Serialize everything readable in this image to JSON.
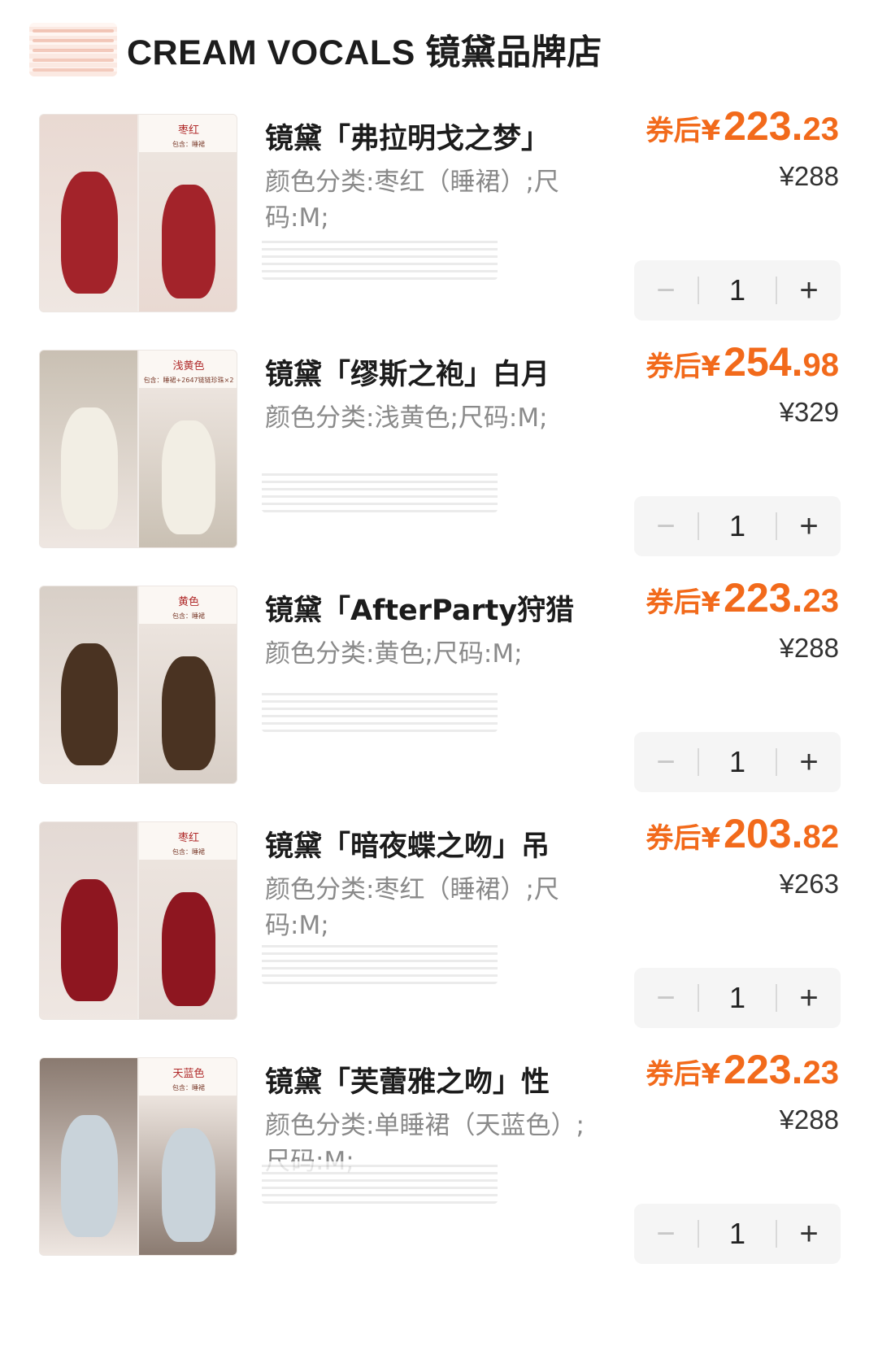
{
  "shop": {
    "name": "CREAM VOCALS 镜黛品牌店",
    "logo_icon": "shop-logo-icon"
  },
  "items": [
    {
      "title": "镜黛「弗拉明戈之梦」",
      "spec": "颜色分类:枣红（睡裙）;尺码:M;",
      "price_prefix": "券后¥",
      "price_int": "223.",
      "price_dec": "23",
      "original_price": "¥288",
      "quantity": "1",
      "thumb_color_label": "枣红",
      "thumb_incl_label": "包含：睡裙",
      "accent": "#a3232a",
      "bg": "#e9d9d2"
    },
    {
      "title": "镜黛「缪斯之袍」白月",
      "spec": "颜色分类:浅黄色;尺码:M;",
      "price_prefix": "券后¥",
      "price_int": "254.",
      "price_dec": "98",
      "original_price": "¥329",
      "quantity": "1",
      "thumb_color_label": "浅黄色",
      "thumb_incl_label": "包含：睡裙+2647链链珍珠×2",
      "accent": "#f2eee4",
      "bg": "#c9c0b3"
    },
    {
      "title": "镜黛「AfterParty狩猎",
      "spec": "颜色分类:黄色;尺码:M;",
      "price_prefix": "券后¥",
      "price_int": "223.",
      "price_dec": "23",
      "original_price": "¥288",
      "quantity": "1",
      "thumb_color_label": "黄色",
      "thumb_incl_label": "包含：睡裙",
      "accent": "#4a3322",
      "bg": "#d8cfc7"
    },
    {
      "title": "镜黛「暗夜蝶之吻」吊",
      "spec": "颜色分类:枣红（睡裙）;尺码:M;",
      "price_prefix": "券后¥",
      "price_int": "203.",
      "price_dec": "82",
      "original_price": "¥263",
      "quantity": "1",
      "thumb_color_label": "枣红",
      "thumb_incl_label": "包含：睡裙",
      "accent": "#8e1620",
      "bg": "#e3d9d4"
    },
    {
      "title": "镜黛「芙蕾雅之吻」性",
      "spec": "颜色分类:单睡裙（天蓝色）;尺码:M;",
      "price_prefix": "券后¥",
      "price_int": "223.",
      "price_dec": "23",
      "original_price": "¥288",
      "quantity": "1",
      "thumb_color_label": "天蓝色",
      "thumb_incl_label": "包含：睡裙",
      "accent": "#c9d3da",
      "bg": "#8a7a70"
    }
  ],
  "stepper": {
    "minus_icon": "minus-icon",
    "plus_icon": "plus-icon",
    "minus_glyph": "−",
    "plus_glyph": "+"
  },
  "colors": {
    "price": "#f26a1b",
    "spec_text": "#8a8a8a",
    "stepper_bg": "#f5f5f5"
  }
}
